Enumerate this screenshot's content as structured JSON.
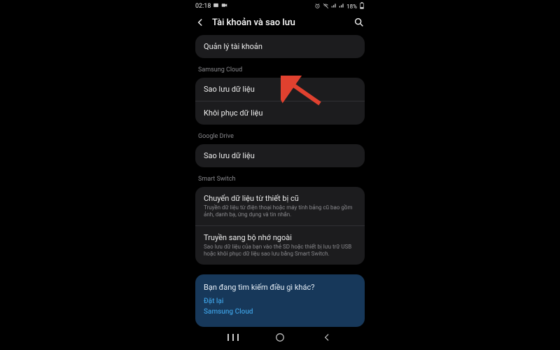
{
  "status": {
    "time": "02:18",
    "battery_text": "18%"
  },
  "header": {
    "title": "Tài khoản và sao lưu"
  },
  "manage": {
    "label": "Quản lý tài khoản"
  },
  "samsung_cloud": {
    "section": "Samsung Cloud",
    "backup": "Sao lưu dữ liệu",
    "restore": "Khôi phục dữ liệu"
  },
  "google_drive": {
    "section": "Google Drive",
    "backup": "Sao lưu dữ liệu"
  },
  "smart_switch": {
    "section": "Smart Switch",
    "transfer_title": "Chuyển dữ liệu từ thiết bị cũ",
    "transfer_desc": "Truyền dữ liệu từ điện thoại hoặc máy tính bảng cũ bao gồm ảnh, danh bạ, ứng dụng và tin nhắn.",
    "external_title": "Truyền sang bộ nhớ ngoài",
    "external_desc": "Sao lưu dữ liệu của bạn vào thẻ SD hoặc thiết bị lưu trữ USB hoặc khôi phục dữ liệu sao lưu bằng Smart Switch."
  },
  "looking": {
    "title": "Bạn đang tìm kiếm điều gì khác?",
    "reset": "Đặt lại",
    "cloud": "Samsung Cloud"
  }
}
